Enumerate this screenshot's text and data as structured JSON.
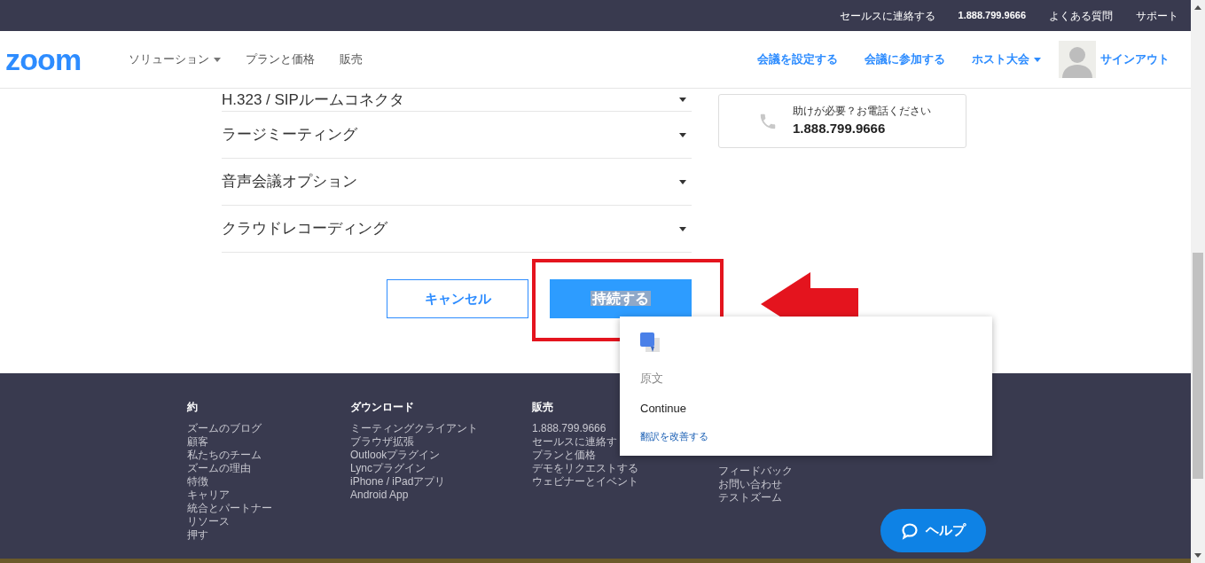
{
  "top_bar": {
    "links": [
      "セールスに連絡する",
      "1.888.799.9666",
      "よくある質問",
      "サポート"
    ]
  },
  "header": {
    "logo": "zoom",
    "nav": [
      {
        "label": "ソリューション",
        "dropdown": true
      },
      {
        "label": "プランと価格",
        "dropdown": false
      },
      {
        "label": "販売",
        "dropdown": false
      }
    ],
    "actions": [
      {
        "label": "会議を設定する",
        "dropdown": false
      },
      {
        "label": "会議に参加する",
        "dropdown": false
      },
      {
        "label": "ホスト大会",
        "dropdown": true
      }
    ],
    "sign_out": "サインアウト"
  },
  "accordion": [
    {
      "label": "H.323 / SIPルームコネクタ",
      "expanded": false
    },
    {
      "label": "ラージミーティング",
      "expanded": false
    },
    {
      "label": "音声会議オプション",
      "expanded": false
    },
    {
      "label": "クラウドレコーディング",
      "expanded": false
    }
  ],
  "help_card": {
    "title": "助けが必要？お電話ください",
    "phone": "1.888.799.9666"
  },
  "buttons": {
    "cancel": "キャンセル",
    "continue": "持続する",
    "continue_text_selected": true
  },
  "footer": {
    "columns": [
      {
        "heading": "約",
        "items": [
          "ズームのブログ",
          "顧客",
          "私たちのチーム",
          "ズームの理由",
          "特徴",
          "キャリア",
          "統合とパートナー",
          "リソース",
          "押す"
        ]
      },
      {
        "heading": "ダウンロード",
        "items": [
          "ミーティングクライアント",
          "ブラウザ拡張",
          "Outlookプラグイン",
          "Lyncプラグイン",
          "iPhone / iPadアプリ",
          "Android App"
        ]
      },
      {
        "heading": "販売",
        "items": [
          "1.888.799.9666",
          "セールスに連絡す",
          "プランと価格",
          "デモをリクエストする",
          "ウェビナーとイベント"
        ]
      },
      {
        "items": [
          "フィードバック",
          "お問い合わせ",
          "テストズーム"
        ]
      }
    ]
  },
  "help_button": "ヘルプ",
  "translate_popup": {
    "original_label": "原文",
    "original_text": "Continue",
    "improve_link": "翻訳を改善する"
  }
}
